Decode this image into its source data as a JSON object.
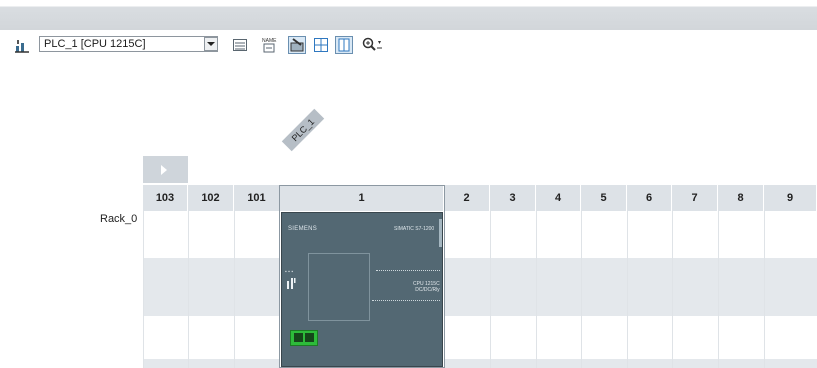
{
  "toolbar": {
    "device_selector": "PLC_1 [CPU 1215C]",
    "icons": [
      "network-view-icon",
      "dropdown-arrow-icon",
      "device-overview-icon",
      "profinet-icon",
      "show-module-labels-icon",
      "grid-icon",
      "page-break-icon",
      "zoom-icon"
    ]
  },
  "rack": {
    "name": "Rack_0",
    "device_label": "PLC_1",
    "slots": [
      "103",
      "102",
      "101",
      "1",
      "2",
      "3",
      "4",
      "5",
      "6",
      "7",
      "8",
      "9"
    ]
  },
  "cpu": {
    "brand": "SIEMENS",
    "model": "SIMATIC S7-1200",
    "type_line1": "CPU 1215C",
    "type_line2": "DC/DC/Rly"
  },
  "colors": {
    "header": "#dde2e7",
    "cpu_body": "#536873",
    "terminal": "#2dbb3a"
  }
}
